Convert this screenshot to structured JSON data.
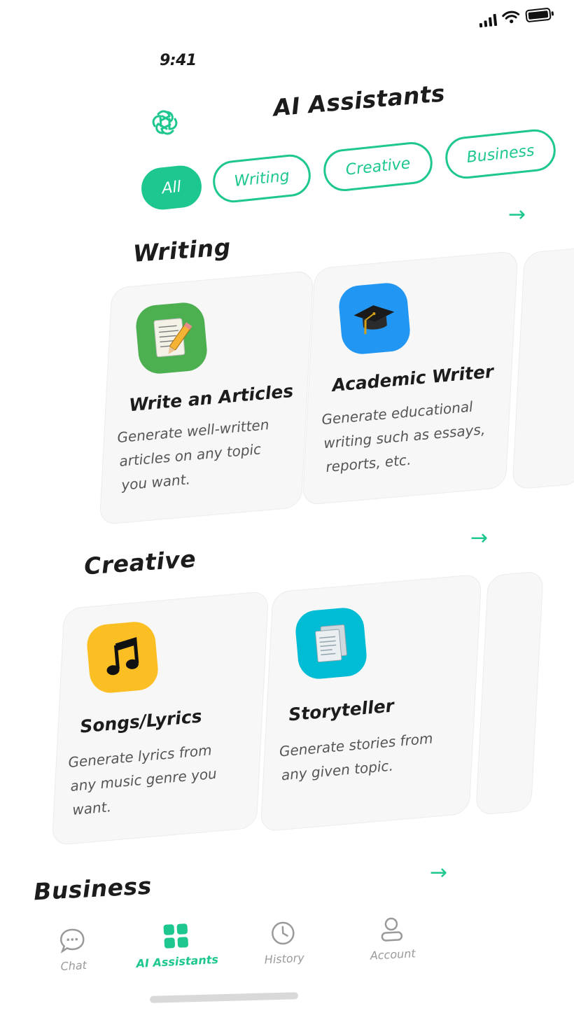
{
  "status_bar": {
    "time": "9:41"
  },
  "header": {
    "title": "AI Assistants",
    "logo_icon": "openai-flower-icon"
  },
  "filters": [
    {
      "label": "All",
      "active": true
    },
    {
      "label": "Writing",
      "active": false
    },
    {
      "label": "Creative",
      "active": false
    },
    {
      "label": "Business",
      "active": false
    }
  ],
  "sections": {
    "writing": {
      "title": "Writing",
      "cards": [
        {
          "title": "Write an Articles",
          "desc": "Generate well-written articles on any topic you want.",
          "icon": "notepad-pencil-icon",
          "icon_color": "#4caf50"
        },
        {
          "title": "Academic Writer",
          "desc": "Generate educational writing such as essays, reports, etc.",
          "icon": "graduation-cap-icon",
          "icon_color": "#2196f3"
        }
      ]
    },
    "creative": {
      "title": "Creative",
      "cards": [
        {
          "title": "Songs/Lyrics",
          "desc": "Generate lyrics from any music genre you want.",
          "icon": "music-note-icon",
          "icon_color": "#fbbf24"
        },
        {
          "title": "Storyteller",
          "desc": "Generate stories from any given topic.",
          "icon": "documents-icon",
          "icon_color": "#00bcd4"
        }
      ]
    },
    "business": {
      "title": "Business"
    }
  },
  "nav": [
    {
      "label": "Chat",
      "icon": "chat-bubble-icon",
      "active": false
    },
    {
      "label": "AI Assistants",
      "icon": "grid-icon",
      "active": true
    },
    {
      "label": "History",
      "icon": "clock-icon",
      "active": false
    },
    {
      "label": "Account",
      "icon": "user-icon",
      "active": false
    }
  ],
  "colors": {
    "accent": "#1dc78f",
    "card_bg": "#f7f7f7"
  }
}
